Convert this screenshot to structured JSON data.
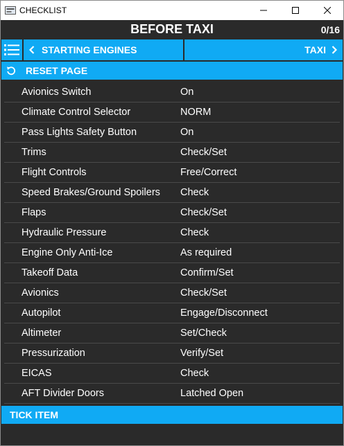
{
  "window": {
    "title": "CHECKLIST",
    "icons": [
      "app-icon",
      "minimize-icon",
      "maximize-icon",
      "close-icon"
    ]
  },
  "header": {
    "title": "BEFORE TAXI",
    "progress": "0/16"
  },
  "nav": {
    "menu_icon": "list-menu-icon",
    "prev_label": "STARTING ENGINES",
    "next_label": "TAXI"
  },
  "reset": {
    "label": "RESET PAGE",
    "icon": "reset-icon"
  },
  "items": [
    {
      "item": "Avionics Switch",
      "value": "On"
    },
    {
      "item": "Climate Control Selector",
      "value": "NORM"
    },
    {
      "item": "Pass Lights Safety Button",
      "value": "On"
    },
    {
      "item": "Trims",
      "value": "Check/Set"
    },
    {
      "item": "Flight Controls",
      "value": "Free/Correct"
    },
    {
      "item": "Speed Brakes/Ground Spoilers",
      "value": "Check"
    },
    {
      "item": "Flaps",
      "value": "Check/Set"
    },
    {
      "item": "Hydraulic Pressure",
      "value": "Check"
    },
    {
      "item": "Engine Only Anti-Ice",
      "value": "As required"
    },
    {
      "item": "Takeoff Data",
      "value": "Confirm/Set"
    },
    {
      "item": "Avionics",
      "value": "Check/Set"
    },
    {
      "item": "Autopilot",
      "value": "Engage/Disconnect"
    },
    {
      "item": "Altimeter",
      "value": "Set/Check"
    },
    {
      "item": "Pressurization",
      "value": "Verify/Set"
    },
    {
      "item": "EICAS",
      "value": "Check"
    },
    {
      "item": "AFT Divider Doors",
      "value": "Latched Open"
    }
  ],
  "footer": {
    "tick_label": "TICK ITEM"
  },
  "colors": {
    "accent": "#10aaf4",
    "background": "#2a2a2a",
    "divider": "#4a4a4a",
    "text": "#ffffff"
  }
}
